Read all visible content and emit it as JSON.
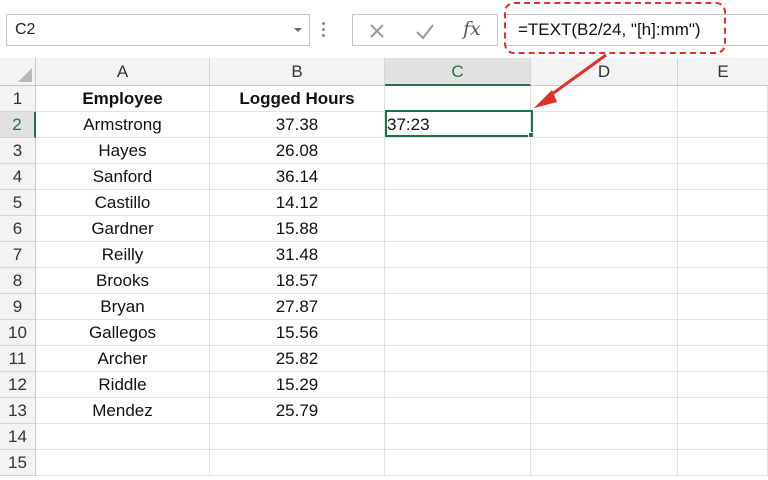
{
  "name_box": {
    "value": "C2"
  },
  "formula_bar": {
    "fx_label": "fx",
    "formula": "=TEXT(B2/24, \"[h]:mm\")"
  },
  "columns": [
    "A",
    "B",
    "C",
    "D",
    "E"
  ],
  "rows": [
    "1",
    "2",
    "3",
    "4",
    "5",
    "6",
    "7",
    "8",
    "9",
    "10",
    "11",
    "12",
    "13",
    "14",
    "15"
  ],
  "table": {
    "headers": [
      "Employee",
      "Logged Hours"
    ],
    "records": [
      {
        "employee": "Armstrong",
        "hours": "37.38"
      },
      {
        "employee": "Hayes",
        "hours": "26.08"
      },
      {
        "employee": "Sanford",
        "hours": "36.14"
      },
      {
        "employee": "Castillo",
        "hours": "14.12"
      },
      {
        "employee": "Gardner",
        "hours": "15.88"
      },
      {
        "employee": "Reilly",
        "hours": "31.48"
      },
      {
        "employee": "Brooks",
        "hours": "18.57"
      },
      {
        "employee": "Bryan",
        "hours": "27.87"
      },
      {
        "employee": "Gallegos",
        "hours": "15.56"
      },
      {
        "employee": "Archer",
        "hours": "25.82"
      },
      {
        "employee": "Riddle",
        "hours": "15.29"
      },
      {
        "employee": "Mendez",
        "hours": "25.79"
      }
    ]
  },
  "selected_cell": {
    "address": "C2",
    "value": "37:23"
  },
  "colors": {
    "selection": "#217346",
    "annotation": "#e0302a"
  }
}
